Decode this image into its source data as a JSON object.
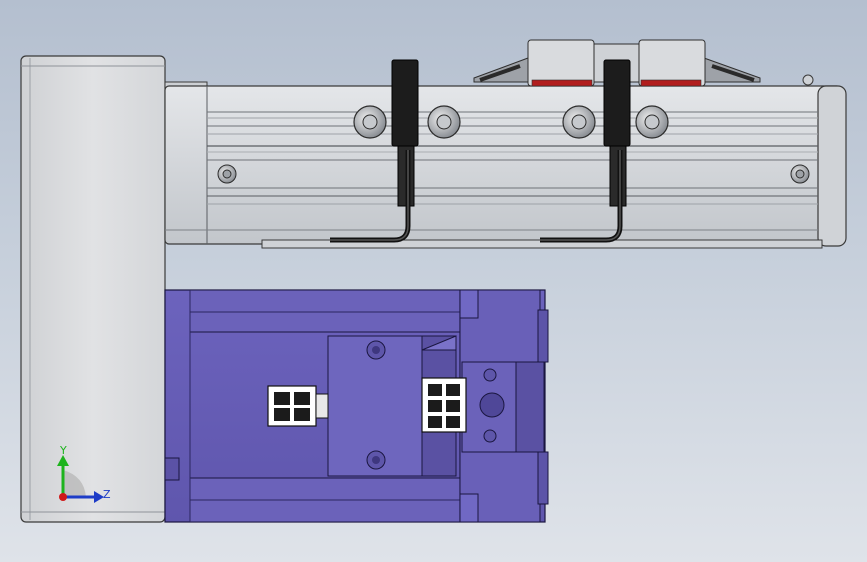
{
  "triad": {
    "y_label": "Y",
    "z_label": "Z",
    "colors": {
      "y_axis": "#1db31d",
      "z_axis": "#1d3cc7",
      "origin": "#d01818"
    }
  },
  "colors": {
    "actuator_body": "#d6d8db",
    "actuator_edge": "#3a3a3a",
    "bracket_plate": "#d9dadc",
    "motor_body": "#6b62b9",
    "motor_dark": "#4b4392",
    "clamp_black": "#1a1a1a",
    "red_accent": "#b11d1d"
  }
}
